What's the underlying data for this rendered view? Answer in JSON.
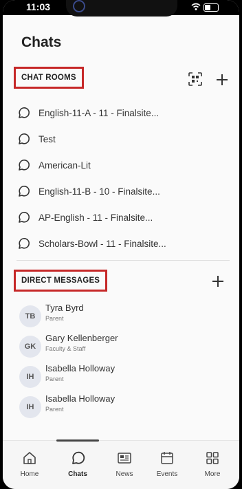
{
  "status_bar": {
    "time": "11:03"
  },
  "header": {
    "title": "Chats"
  },
  "chat_rooms": {
    "heading": "CHAT ROOMS",
    "items": [
      {
        "label": "English-11-A - 11 - Finalsite..."
      },
      {
        "label": "Test"
      },
      {
        "label": "American-Lit"
      },
      {
        "label": "English-11-B - 10 - Finalsite..."
      },
      {
        "label": "AP-English - 11 - Finalsite..."
      },
      {
        "label": "Scholars-Bowl - 11 - Finalsite..."
      }
    ]
  },
  "direct_messages": {
    "heading": "DIRECT MESSAGES",
    "items": [
      {
        "initials": "TB",
        "name": "Tyra Byrd",
        "role": "Parent"
      },
      {
        "initials": "GK",
        "name": "Gary Kellenberger",
        "role": "Faculty & Staff"
      },
      {
        "initials": "IH",
        "name": "Isabella Holloway",
        "role": "Parent"
      },
      {
        "initials": "IH",
        "name": "Isabella Holloway",
        "role": "Parent"
      }
    ]
  },
  "tabs": [
    {
      "label": "Home",
      "icon": "home-icon"
    },
    {
      "label": "Chats",
      "icon": "chat-icon",
      "active": true
    },
    {
      "label": "News",
      "icon": "news-icon"
    },
    {
      "label": "Events",
      "icon": "calendar-icon"
    },
    {
      "label": "More",
      "icon": "grid-icon"
    }
  ],
  "colors": {
    "highlight_border": "#c62828",
    "avatar_bg": "#e3e6ee"
  }
}
